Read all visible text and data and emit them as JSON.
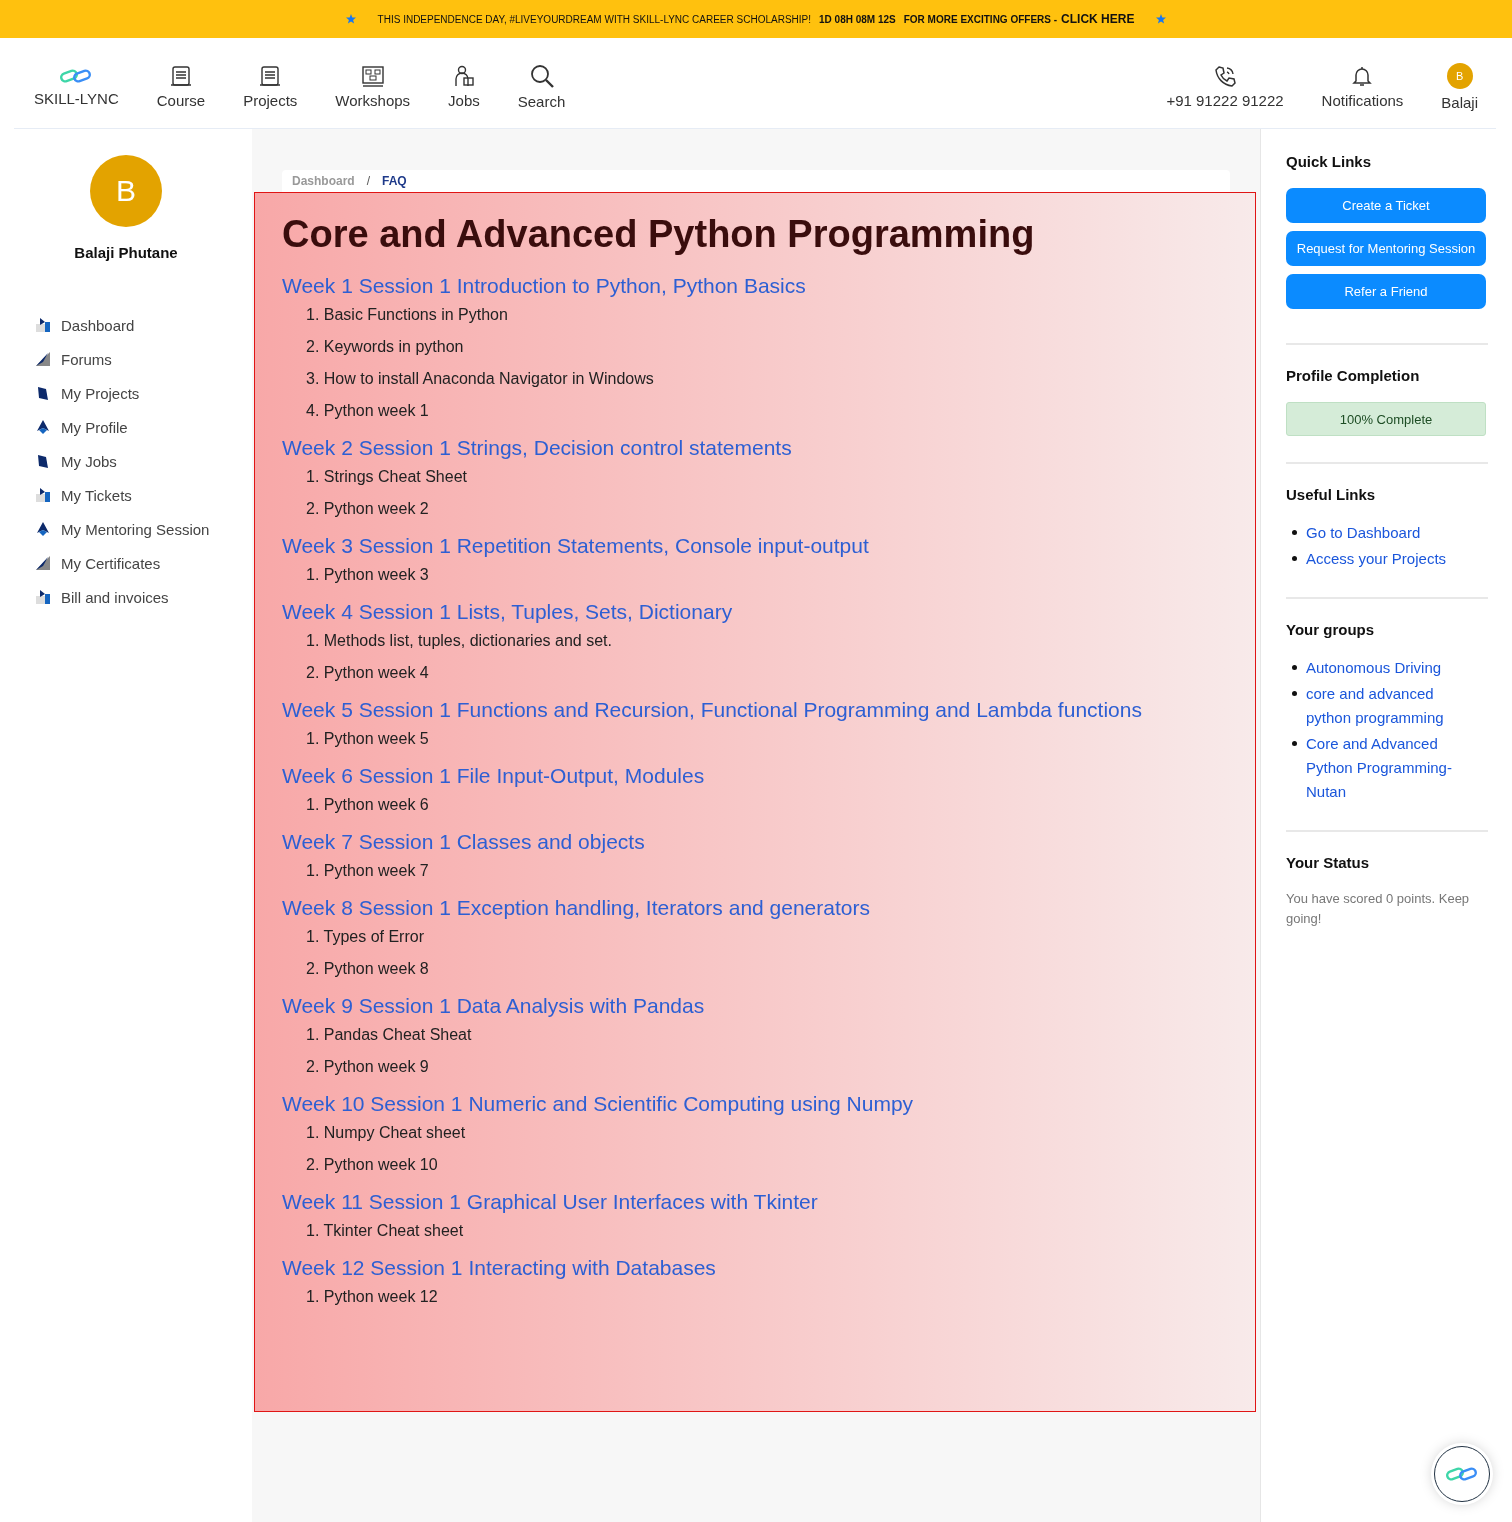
{
  "banner": {
    "message": "THIS INDEPENDENCE DAY, #LIVEYOURDREAM WITH SKILL-LYNC CAREER SCHOLARSHIP!",
    "countdown": "1D 08H 08M 12S",
    "offer": "FOR MORE EXCITING OFFERS -",
    "cta": "CLICK HERE"
  },
  "nav": {
    "items": [
      {
        "kind": "logo",
        "label": "SKILL-LYNC"
      },
      {
        "kind": "course",
        "label": "Course"
      },
      {
        "kind": "projects",
        "label": "Projects"
      },
      {
        "kind": "workshops",
        "label": "Workshops"
      },
      {
        "kind": "jobs",
        "label": "Jobs"
      },
      {
        "kind": "search",
        "label": "Search"
      }
    ],
    "right": [
      {
        "kind": "phone",
        "label": "+91 91222 91222"
      },
      {
        "kind": "bell",
        "label": "Notifications"
      },
      {
        "kind": "avatar",
        "label": "Balaji",
        "initial": "B"
      }
    ]
  },
  "sidebar": {
    "avatar_initial": "B",
    "user_name": "Balaji Phutane",
    "items": [
      {
        "label": "Dashboard"
      },
      {
        "label": "Forums"
      },
      {
        "label": "My Projects"
      },
      {
        "label": "My Profile"
      },
      {
        "label": "My Jobs"
      },
      {
        "label": "My Tickets"
      },
      {
        "label": "My Mentoring Session"
      },
      {
        "label": "My Certificates"
      },
      {
        "label": "Bill and invoices"
      }
    ]
  },
  "breadcrumb": [
    {
      "label": "Dashboard",
      "selected": false
    },
    {
      "label": "/",
      "kind": "separator"
    },
    {
      "label": "FAQ",
      "selected": true
    }
  ],
  "title": "Core and Advanced Python Programming",
  "weeks": [
    {
      "heading": "Week 1 Session 1 Introduction to Python, Python Basics",
      "items": [
        "1. Basic Functions in Python",
        "2. Keywords in python",
        "3. How to install Anaconda Navigator in Windows",
        "4. Python week 1"
      ]
    },
    {
      "heading": "Week 2 Session 1 Strings, Decision control statements",
      "items": [
        "1. Strings Cheat Sheet",
        "2. Python week 2"
      ]
    },
    {
      "heading": "Week 3 Session 1 Repetition Statements, Console input-output",
      "items": [
        "1. Python week 3"
      ]
    },
    {
      "heading": "Week 4 Session 1 Lists, Tuples, Sets, Dictionary",
      "items": [
        "1. Methods list, tuples, dictionaries and set.",
        "2. Python week 4"
      ]
    },
    {
      "heading": "Week 5 Session 1 Functions and Recursion, Functional Programming and Lambda functions",
      "items": [
        "1. Python week 5"
      ]
    },
    {
      "heading": "Week 6 Session 1 File Input-Output, Modules",
      "items": [
        "1. Python week 6"
      ]
    },
    {
      "heading": "Week 7 Session 1 Classes and objects",
      "items": [
        "1. Python week 7"
      ]
    },
    {
      "heading": "Week 8 Session 1 Exception handling, Iterators and generators",
      "items": [
        "1. Types of Error",
        "2. Python week 8"
      ]
    },
    {
      "heading": "Week 9 Session 1 Data Analysis with Pandas",
      "items": [
        "1. Pandas Cheat Sheat",
        "2. Python week 9"
      ]
    },
    {
      "heading": "Week 10 Session 1 Numeric and Scientific Computing using Numpy",
      "items": [
        "1. Numpy Cheat sheet",
        "2. Python week 10"
      ]
    },
    {
      "heading": "Week 11 Session 1 Graphical User Interfaces with Tkinter",
      "items": [
        "1. Tkinter Cheat sheet"
      ]
    },
    {
      "heading": "Week 12 Session 1 Interacting with Databases",
      "items": [
        "1. Python week 12"
      ]
    }
  ],
  "right_panel": {
    "quick_links": {
      "title": "Quick Links",
      "buttons": [
        "Create a Ticket",
        "Request for Mentoring Session",
        "Refer a Friend"
      ]
    },
    "profile_completion": {
      "title": "Profile Completion",
      "status": "100% Complete",
      "level": 1
    },
    "useful_links": {
      "title": "Useful Links",
      "links": [
        "Go to Dashboard",
        "Access your Projects"
      ]
    },
    "groups": {
      "title": "Your groups",
      "links": [
        "Autonomous Driving",
        "core and advanced python programming",
        "Core and Advanced Python Programming-Nutan"
      ]
    },
    "status": {
      "title": "Your Status",
      "text": "You have scored 0 points. Keep going!"
    }
  }
}
